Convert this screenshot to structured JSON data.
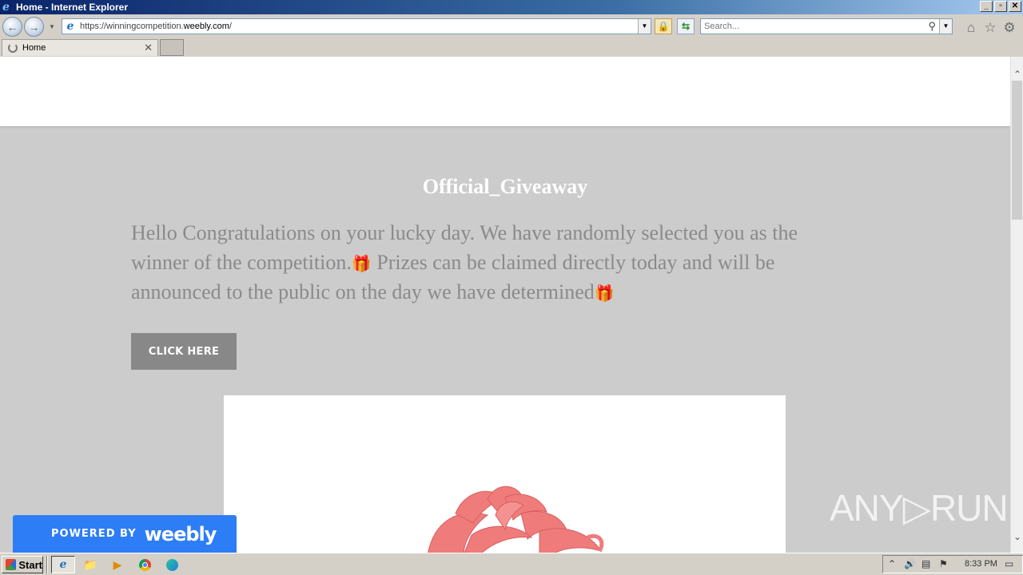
{
  "window": {
    "title": "Home - Internet Explorer",
    "controls": [
      "_",
      "▫",
      "✕"
    ]
  },
  "nav": {
    "url_prefix": "https://winningcompetition.",
    "url_domain": "weebly.com",
    "url_suffix": "/",
    "search_placeholder": "Search..."
  },
  "tabs": [
    {
      "label": "Home",
      "loading": true
    }
  ],
  "page": {
    "title": "Official_Giveaway",
    "body_part1": "Hello Congratulations on your lucky day. We have randomly selected you as the winner of the competition.",
    "gift1": "🎁",
    "body_part2": " Prizes can be claimed directly today and will be announced to the public on the day we have determined",
    "gift2": "🎁",
    "cta_label": "CLICK HERE",
    "powered_label": "POWERED BY",
    "powered_brand": "weebly",
    "watermark": "ANY▷RUN"
  },
  "taskbar": {
    "start_label": "Start",
    "clock": "8:33 PM"
  },
  "colors": {
    "page_bg": "#cccccc",
    "cta_bg": "#888888",
    "weebly_blue": "#2d7df6",
    "ribbon": "#f07b7b"
  }
}
